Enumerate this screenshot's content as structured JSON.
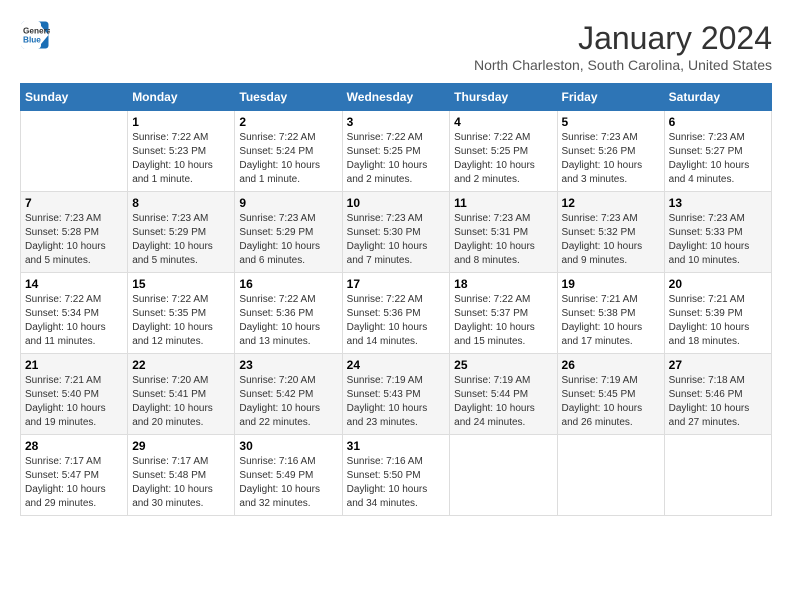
{
  "header": {
    "logo_line1": "General",
    "logo_line2": "Blue",
    "month_title": "January 2024",
    "location": "North Charleston, South Carolina, United States"
  },
  "weekdays": [
    "Sunday",
    "Monday",
    "Tuesday",
    "Wednesday",
    "Thursday",
    "Friday",
    "Saturday"
  ],
  "weeks": [
    [
      {
        "day": "",
        "sunrise": "",
        "sunset": "",
        "daylight": ""
      },
      {
        "day": "1",
        "sunrise": "7:22 AM",
        "sunset": "5:23 PM",
        "daylight": "10 hours and 1 minute."
      },
      {
        "day": "2",
        "sunrise": "7:22 AM",
        "sunset": "5:24 PM",
        "daylight": "10 hours and 1 minute."
      },
      {
        "day": "3",
        "sunrise": "7:22 AM",
        "sunset": "5:25 PM",
        "daylight": "10 hours and 2 minutes."
      },
      {
        "day": "4",
        "sunrise": "7:22 AM",
        "sunset": "5:25 PM",
        "daylight": "10 hours and 2 minutes."
      },
      {
        "day": "5",
        "sunrise": "7:23 AM",
        "sunset": "5:26 PM",
        "daylight": "10 hours and 3 minutes."
      },
      {
        "day": "6",
        "sunrise": "7:23 AM",
        "sunset": "5:27 PM",
        "daylight": "10 hours and 4 minutes."
      }
    ],
    [
      {
        "day": "7",
        "sunrise": "7:23 AM",
        "sunset": "5:28 PM",
        "daylight": "10 hours and 5 minutes."
      },
      {
        "day": "8",
        "sunrise": "7:23 AM",
        "sunset": "5:29 PM",
        "daylight": "10 hours and 5 minutes."
      },
      {
        "day": "9",
        "sunrise": "7:23 AM",
        "sunset": "5:29 PM",
        "daylight": "10 hours and 6 minutes."
      },
      {
        "day": "10",
        "sunrise": "7:23 AM",
        "sunset": "5:30 PM",
        "daylight": "10 hours and 7 minutes."
      },
      {
        "day": "11",
        "sunrise": "7:23 AM",
        "sunset": "5:31 PM",
        "daylight": "10 hours and 8 minutes."
      },
      {
        "day": "12",
        "sunrise": "7:23 AM",
        "sunset": "5:32 PM",
        "daylight": "10 hours and 9 minutes."
      },
      {
        "day": "13",
        "sunrise": "7:23 AM",
        "sunset": "5:33 PM",
        "daylight": "10 hours and 10 minutes."
      }
    ],
    [
      {
        "day": "14",
        "sunrise": "7:22 AM",
        "sunset": "5:34 PM",
        "daylight": "10 hours and 11 minutes."
      },
      {
        "day": "15",
        "sunrise": "7:22 AM",
        "sunset": "5:35 PM",
        "daylight": "10 hours and 12 minutes."
      },
      {
        "day": "16",
        "sunrise": "7:22 AM",
        "sunset": "5:36 PM",
        "daylight": "10 hours and 13 minutes."
      },
      {
        "day": "17",
        "sunrise": "7:22 AM",
        "sunset": "5:36 PM",
        "daylight": "10 hours and 14 minutes."
      },
      {
        "day": "18",
        "sunrise": "7:22 AM",
        "sunset": "5:37 PM",
        "daylight": "10 hours and 15 minutes."
      },
      {
        "day": "19",
        "sunrise": "7:21 AM",
        "sunset": "5:38 PM",
        "daylight": "10 hours and 17 minutes."
      },
      {
        "day": "20",
        "sunrise": "7:21 AM",
        "sunset": "5:39 PM",
        "daylight": "10 hours and 18 minutes."
      }
    ],
    [
      {
        "day": "21",
        "sunrise": "7:21 AM",
        "sunset": "5:40 PM",
        "daylight": "10 hours and 19 minutes."
      },
      {
        "day": "22",
        "sunrise": "7:20 AM",
        "sunset": "5:41 PM",
        "daylight": "10 hours and 20 minutes."
      },
      {
        "day": "23",
        "sunrise": "7:20 AM",
        "sunset": "5:42 PM",
        "daylight": "10 hours and 22 minutes."
      },
      {
        "day": "24",
        "sunrise": "7:19 AM",
        "sunset": "5:43 PM",
        "daylight": "10 hours and 23 minutes."
      },
      {
        "day": "25",
        "sunrise": "7:19 AM",
        "sunset": "5:44 PM",
        "daylight": "10 hours and 24 minutes."
      },
      {
        "day": "26",
        "sunrise": "7:19 AM",
        "sunset": "5:45 PM",
        "daylight": "10 hours and 26 minutes."
      },
      {
        "day": "27",
        "sunrise": "7:18 AM",
        "sunset": "5:46 PM",
        "daylight": "10 hours and 27 minutes."
      }
    ],
    [
      {
        "day": "28",
        "sunrise": "7:17 AM",
        "sunset": "5:47 PM",
        "daylight": "10 hours and 29 minutes."
      },
      {
        "day": "29",
        "sunrise": "7:17 AM",
        "sunset": "5:48 PM",
        "daylight": "10 hours and 30 minutes."
      },
      {
        "day": "30",
        "sunrise": "7:16 AM",
        "sunset": "5:49 PM",
        "daylight": "10 hours and 32 minutes."
      },
      {
        "day": "31",
        "sunrise": "7:16 AM",
        "sunset": "5:50 PM",
        "daylight": "10 hours and 34 minutes."
      },
      {
        "day": "",
        "sunrise": "",
        "sunset": "",
        "daylight": ""
      },
      {
        "day": "",
        "sunrise": "",
        "sunset": "",
        "daylight": ""
      },
      {
        "day": "",
        "sunrise": "",
        "sunset": "",
        "daylight": ""
      }
    ]
  ]
}
